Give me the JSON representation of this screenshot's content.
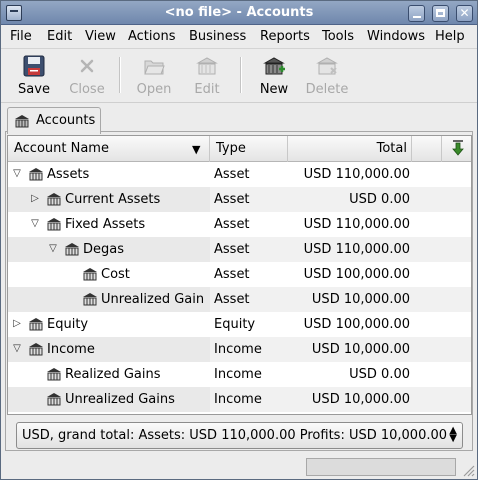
{
  "window": {
    "title": "<no file> - Accounts",
    "title_bar_color": "#7d93b6"
  },
  "menubar": {
    "items": [
      "File",
      "Edit",
      "View",
      "Actions",
      "Business",
      "Reports",
      "Tools",
      "Windows",
      "Help"
    ]
  },
  "toolbar": {
    "save": {
      "label": "Save",
      "icon": "floppy-disk-icon",
      "enabled": true
    },
    "close": {
      "label": "Close",
      "icon": "close-x-icon",
      "enabled": false
    },
    "open": {
      "label": "Open",
      "icon": "open-folder-icon",
      "enabled": false
    },
    "edit": {
      "label": "Edit",
      "icon": "edit-account-icon",
      "enabled": false
    },
    "new": {
      "label": "New",
      "icon": "new-account-icon",
      "enabled": true
    },
    "delete": {
      "label": "Delete",
      "icon": "delete-account-icon",
      "enabled": false
    }
  },
  "tabs": [
    {
      "label": "Accounts",
      "icon": "bank-icon",
      "active": true
    }
  ],
  "tree": {
    "columns": {
      "name": "Account Name",
      "type": "Type",
      "total": "Total"
    },
    "rows": [
      {
        "name": "Assets",
        "type": "Asset",
        "total": "USD 110,000.00",
        "depth": 0,
        "expander": "expanded"
      },
      {
        "name": "Current Assets",
        "type": "Asset",
        "total": "USD 0.00",
        "depth": 1,
        "expander": "collapsed"
      },
      {
        "name": "Fixed Assets",
        "type": "Asset",
        "total": "USD 110,000.00",
        "depth": 1,
        "expander": "expanded"
      },
      {
        "name": "Degas",
        "type": "Asset",
        "total": "USD 110,000.00",
        "depth": 2,
        "expander": "expanded"
      },
      {
        "name": "Cost",
        "type": "Asset",
        "total": "USD 100,000.00",
        "depth": 3,
        "expander": "none"
      },
      {
        "name": "Unrealized Gain",
        "type": "Asset",
        "total": "USD 10,000.00",
        "depth": 3,
        "expander": "none"
      },
      {
        "name": "Equity",
        "type": "Equity",
        "total": "USD 100,000.00",
        "depth": 0,
        "expander": "collapsed"
      },
      {
        "name": "Income",
        "type": "Income",
        "total": "USD 10,000.00",
        "depth": 0,
        "expander": "expanded"
      },
      {
        "name": "Realized Gains",
        "type": "Income",
        "total": "USD 0.00",
        "depth": 1,
        "expander": "none"
      },
      {
        "name": "Unrealized Gains",
        "type": "Income",
        "total": "USD 10,000.00",
        "depth": 1,
        "expander": "none"
      }
    ]
  },
  "summary": {
    "text": "USD, grand total: Assets: USD 110,000.00 Profits: USD 10,000.00"
  },
  "colors": {
    "accent_green": "#3a8a2a",
    "disabled_text": "#a8a8a8"
  }
}
